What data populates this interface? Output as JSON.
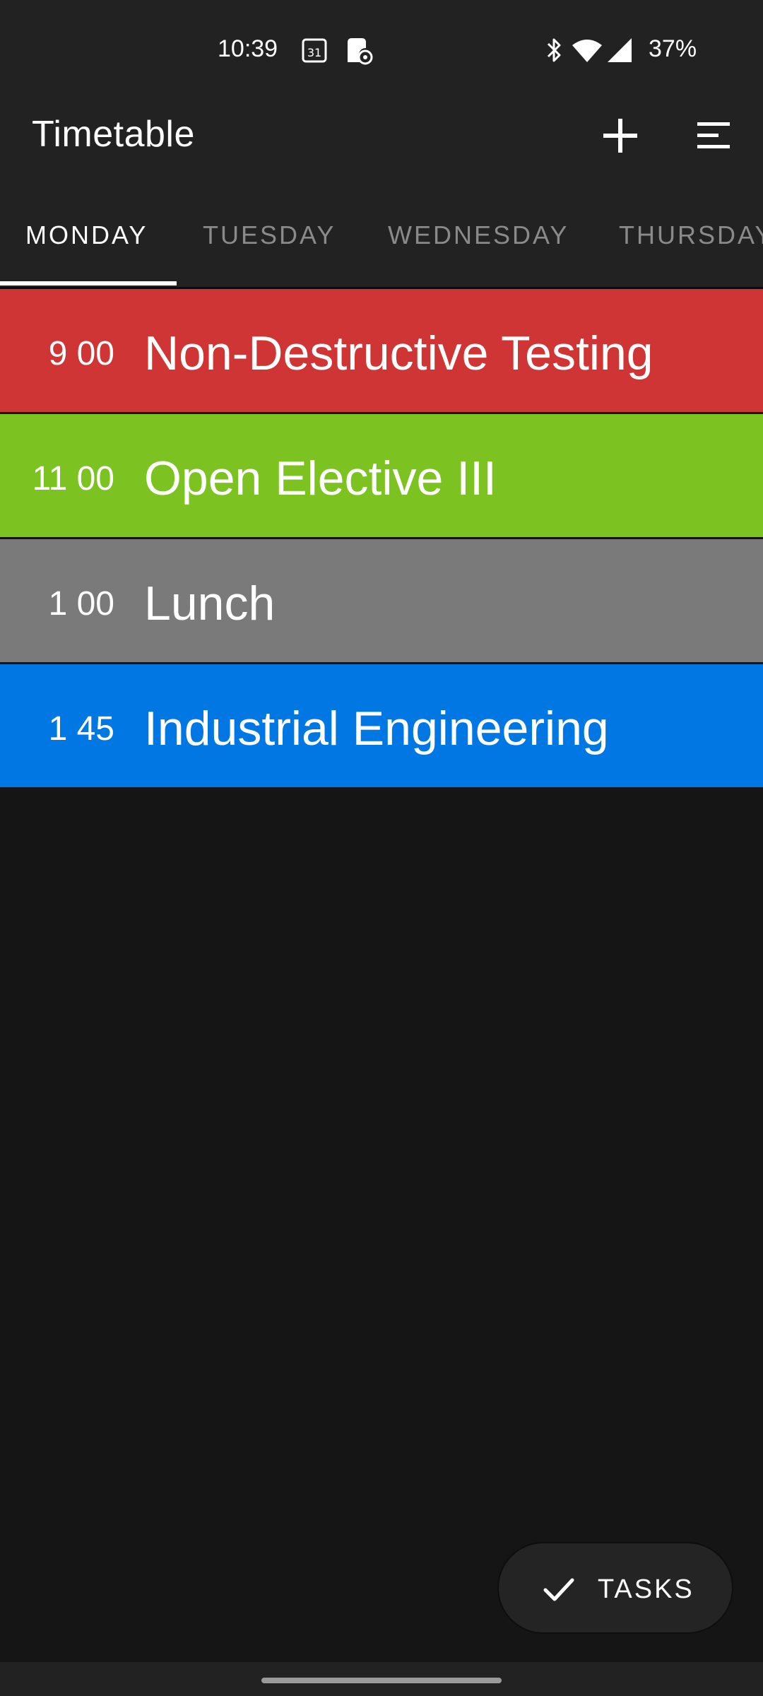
{
  "status_bar": {
    "time": "10:39",
    "calendar_icon_text": "31",
    "battery": "37%",
    "icons": [
      "calendar-icon",
      "app-notification-icon",
      "bluetooth-icon",
      "wifi-icon",
      "signal-icon"
    ]
  },
  "app_bar": {
    "title": "Timetable",
    "add_icon": "plus-icon",
    "menu_icon": "menu-icon"
  },
  "tabs": [
    {
      "label": "MONDAY",
      "active": true
    },
    {
      "label": "TUESDAY",
      "active": false
    },
    {
      "label": "WEDNESDAY",
      "active": false
    },
    {
      "label": "THURSDAY",
      "active": false
    }
  ],
  "schedule": [
    {
      "time": "9 00",
      "title": "Non-Destructive Testing",
      "color": "#D03535"
    },
    {
      "time": "11 00",
      "title": "Open Elective III",
      "color": "#7CC221"
    },
    {
      "time": "1 00",
      "title": "Lunch",
      "color": "#7A7A7A"
    },
    {
      "time": "1 45",
      "title": "Industrial Engineering",
      "color": "#0077E3"
    }
  ],
  "fab": {
    "label": "TASKS",
    "icon": "check-icon"
  },
  "colors": {
    "app_bar": "#222222",
    "background": "#151515",
    "tab_inactive": "#8A8A8A"
  }
}
